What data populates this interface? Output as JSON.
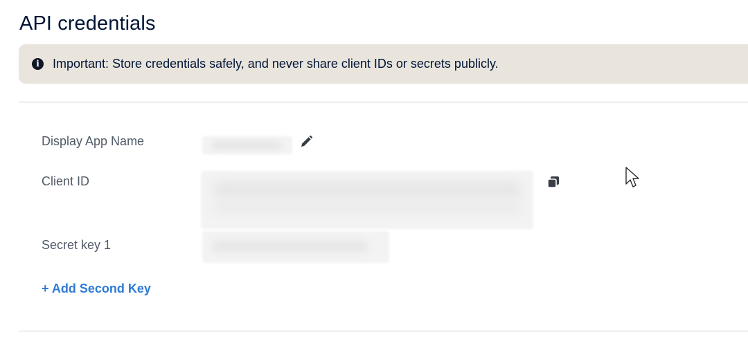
{
  "page": {
    "title": "API credentials"
  },
  "notice": {
    "icon": "info-icon",
    "text": "Important: Store credentials safely, and never share client IDs or secrets publicly."
  },
  "fields": {
    "display_app_name": {
      "label": "Display App Name",
      "action_icon": "pencil-icon"
    },
    "client_id": {
      "label": "Client ID",
      "action_icon": "copy-icon"
    },
    "secret_key_1": {
      "label": "Secret key 1"
    }
  },
  "actions": {
    "add_second_key": "+ Add Second Key"
  },
  "colors": {
    "title": "#001435",
    "notice_background": "#e9e5dd",
    "label": "#515a67",
    "link": "#2e7bd6",
    "divider": "#cfcfcf"
  }
}
